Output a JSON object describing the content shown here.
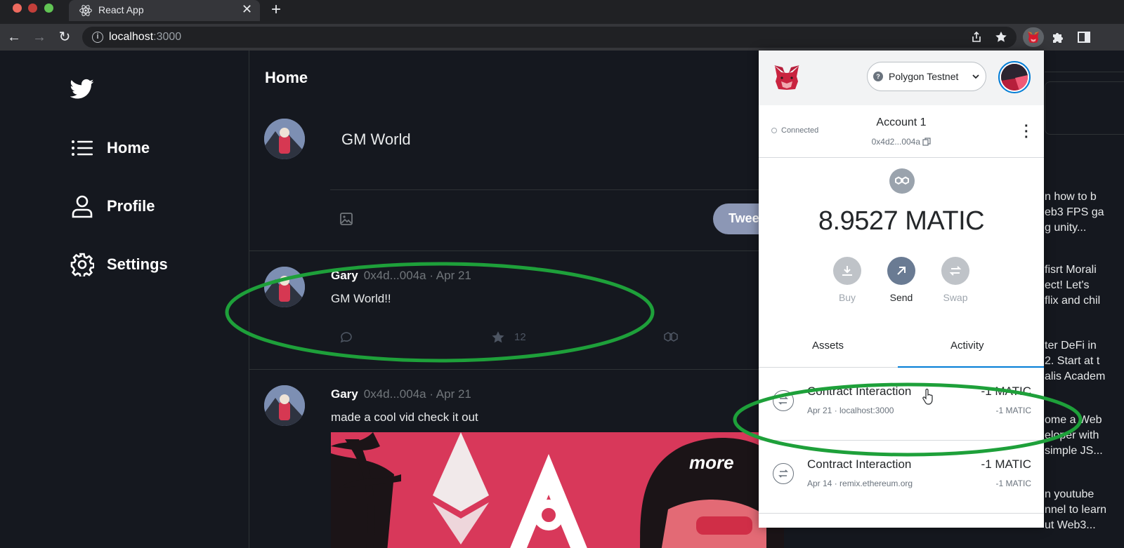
{
  "browser": {
    "tab_title": "React App",
    "tab_close": "✕",
    "new_tab": "+",
    "url_host": "localhost",
    "url_port": ":3000"
  },
  "sidebar": {
    "items": [
      {
        "label": "Home",
        "icon": "list-icon"
      },
      {
        "label": "Profile",
        "icon": "user-icon"
      },
      {
        "label": "Settings",
        "icon": "gear-icon"
      }
    ]
  },
  "feed": {
    "title": "Home",
    "compose_text": "GM World",
    "tweet_button": "Tweet",
    "posts": [
      {
        "name": "Gary",
        "meta": "0x4d...004a · Apr 21",
        "text": "GM World!!",
        "stars": "12"
      },
      {
        "name": "Gary",
        "meta": "0x4d...004a · Apr 21",
        "text": "made a cool vid check it out"
      }
    ]
  },
  "right_column": {
    "lines": [
      "n how to b",
      "eb3 FPS ga",
      "g unity...",
      "fisrt Morali",
      "ect! Let's",
      "flix and chil",
      "ter DeFi in",
      "2. Start at t",
      "alis Academ",
      "ome a Web",
      "eloper with",
      "simple JS...",
      "n youtube",
      "nnel to learn",
      "ut Web3..."
    ]
  },
  "metamask": {
    "network": "Polygon Testnet",
    "connected_label": "Connected",
    "account_name": "Account 1",
    "account_address": "0x4d2...004a",
    "balance": "8.9527 MATIC",
    "actions": [
      {
        "label": "Buy",
        "icon": "download-icon"
      },
      {
        "label": "Send",
        "icon": "arrow-up-right-icon"
      },
      {
        "label": "Swap",
        "icon": "swap-icon"
      }
    ],
    "tabs": [
      "Assets",
      "Activity"
    ],
    "transactions": [
      {
        "title": "Contract Interaction",
        "subtitle": "Apr 21 · localhost:3000",
        "amount": "-1 MATIC",
        "amount_secondary": "-1 MATIC"
      },
      {
        "title": "Contract Interaction",
        "subtitle": "Apr 14 · remix.ethereum.org",
        "amount": "-1 MATIC",
        "amount_secondary": "-1 MATIC"
      }
    ]
  },
  "colors": {
    "annotation": "#1ea03a",
    "app_background": "#15181f",
    "tweet_button": "#8c97b5",
    "metamask_accent": "#037dd6"
  }
}
